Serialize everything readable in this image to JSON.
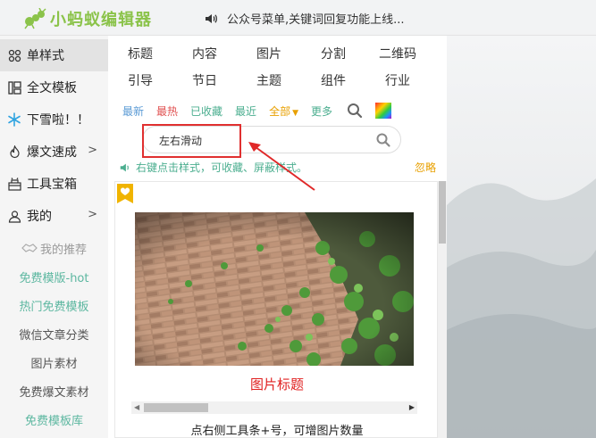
{
  "app": {
    "logo_text": "小蚂蚁编辑器"
  },
  "notice": {
    "text": "公众号菜单,关键词回复功能上线..."
  },
  "sidebar": {
    "items": [
      {
        "label": "单样式",
        "icon": "grid-icon"
      },
      {
        "label": "全文模板",
        "icon": "layout-icon"
      },
      {
        "label": "下雪啦！！",
        "icon": "snowflake-icon"
      },
      {
        "label": "爆文速成",
        "icon": "fire-icon"
      },
      {
        "label": "工具宝箱",
        "icon": "toolbox-icon"
      },
      {
        "label": "我的",
        "icon": "user-icon"
      }
    ],
    "subitems": [
      {
        "label": "我的推荐"
      },
      {
        "label": "免费模版-hot"
      },
      {
        "label": "热门免费模板"
      },
      {
        "label": "微信文章分类"
      },
      {
        "label": "图片素材"
      },
      {
        "label": "免费爆文素材"
      },
      {
        "label": "免费模板库"
      }
    ]
  },
  "categories": {
    "row1": [
      "标题",
      "内容",
      "图片",
      "分割",
      "二维码"
    ],
    "row2": [
      "引导",
      "节日",
      "主题",
      "组件",
      "行业"
    ]
  },
  "filters": [
    "最新",
    "最热",
    "已收藏",
    "最近",
    "全部",
    "更多"
  ],
  "search": {
    "value": "左右滑动"
  },
  "tip": {
    "text": "右键点击样式，可收藏、屏蔽样式。",
    "ignore": "忽略"
  },
  "card": {
    "caption": "图片标题",
    "note": "点右侧工具条+号，可增图片数量"
  },
  "colors": {
    "brand_green": "#8bc34a",
    "accent_red": "#e02020",
    "orange": "#e8a000"
  }
}
